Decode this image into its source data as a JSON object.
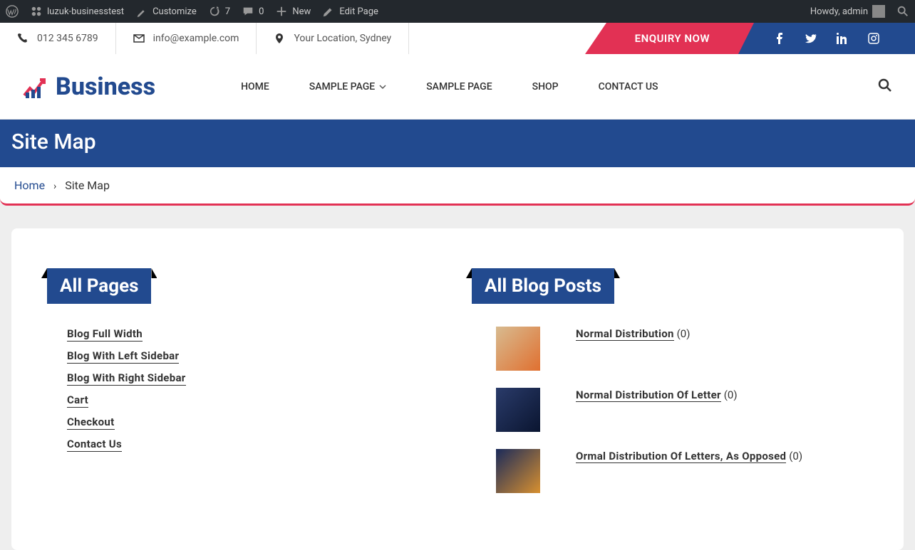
{
  "admin": {
    "site_name": "luzuk-businesstest",
    "customize": "Customize",
    "updates": "7",
    "comments": "0",
    "new": "New",
    "edit": "Edit Page",
    "howdy": "Howdy, admin"
  },
  "contact": {
    "phone": "012 345 6789",
    "email": "info@example.com",
    "location": "Your Location, Sydney",
    "enquiry": "ENQUIRY NOW"
  },
  "logo_text": "Business",
  "nav": {
    "home": "HOME",
    "sample1": "SAMPLE PAGE",
    "sample2": "SAMPLE PAGE",
    "shop": "SHOP",
    "contact": "CONTACT US"
  },
  "page_title": "Site Map",
  "breadcrumb": {
    "home": "Home",
    "current": "Site Map"
  },
  "headings": {
    "pages": "All Pages",
    "posts": "All Blog Posts"
  },
  "pages": [
    "Blog Full Width",
    "Blog With Left Sidebar",
    "Blog With Right Sidebar",
    "Cart",
    "Checkout",
    "Contact Us"
  ],
  "posts": [
    {
      "title": "Normal Distribution",
      "count": "(0)"
    },
    {
      "title": "Normal Distribution Of Letter",
      "count": "(0)"
    },
    {
      "title": "Ormal Distribution Of Letters, As Opposed",
      "count": "(0)"
    }
  ]
}
